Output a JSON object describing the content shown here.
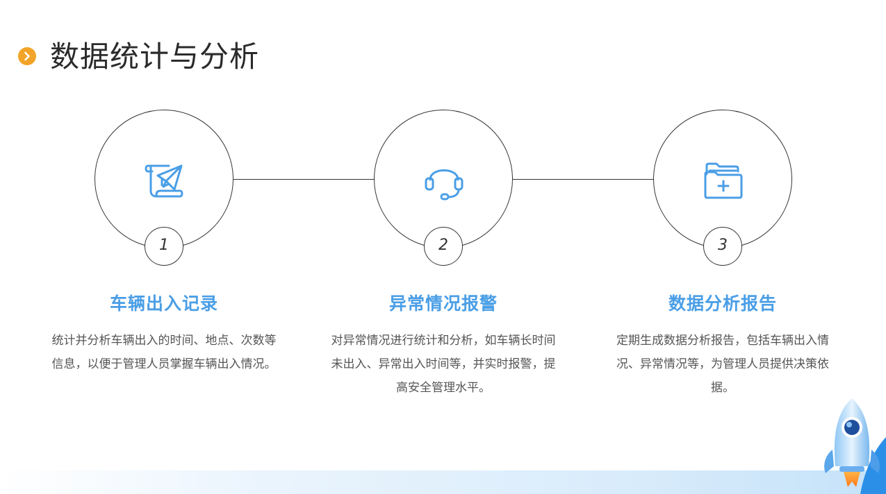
{
  "title": "数据统计与分析",
  "colors": {
    "accent": "#4a9ee6",
    "bullet": "#f2a428",
    "line": "#333333",
    "text": "#555555"
  },
  "steps": [
    {
      "number": "1",
      "icon": "paper-plane-scroll-icon",
      "title": "车辆出入记录",
      "description": "统计并分析车辆出入的时间、地点、次数等信息，以便于管理人员掌握车辆出入情况。"
    },
    {
      "number": "2",
      "icon": "headset-icon",
      "title": "异常情况报警",
      "description": "对异常情况进行统计和分析，如车辆长时间未出入、异常出入时间等，并实时报警，提高安全管理水平。"
    },
    {
      "number": "3",
      "icon": "folder-add-icon",
      "title": "数据分析报告",
      "description": "定期生成数据分析报告，包括车辆出入情况、异常情况等，为管理人员提供决策依据。"
    }
  ]
}
